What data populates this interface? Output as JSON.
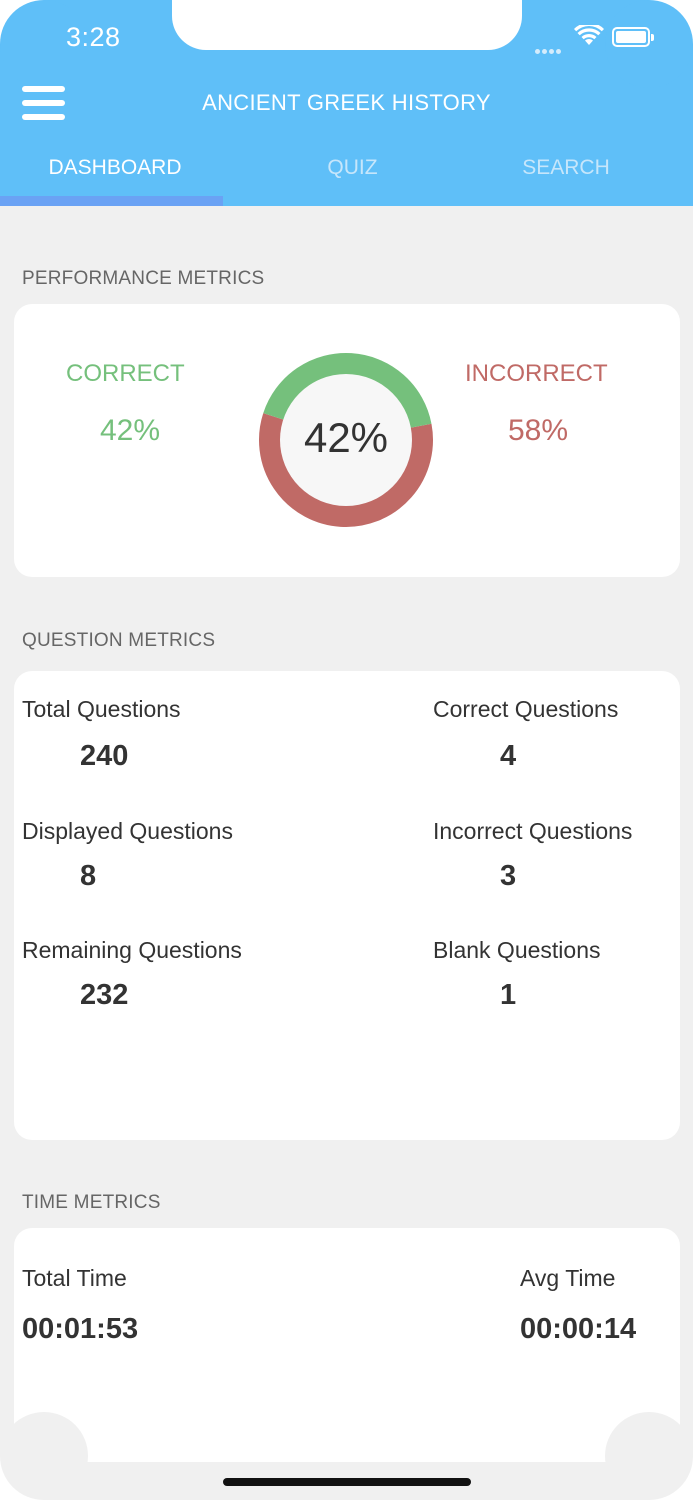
{
  "status_bar": {
    "time": "3:28"
  },
  "header": {
    "title": "ANCIENT GREEK HISTORY",
    "tabs": [
      {
        "label": "DASHBOARD",
        "active": true
      },
      {
        "label": "QUIZ",
        "active": false
      },
      {
        "label": "SEARCH",
        "active": false
      }
    ]
  },
  "performance": {
    "section_title": "PERFORMANCE METRICS",
    "correct_label": "CORRECT",
    "correct_value": "42%",
    "incorrect_label": "INCORRECT",
    "incorrect_value": "58%",
    "donut_center": "42%",
    "correct_fraction": 0.42,
    "colors": {
      "correct": "#75c07c",
      "incorrect": "#c06a66"
    }
  },
  "questions": {
    "section_title": "QUESTION METRICS",
    "total_label": "Total Questions",
    "total_value": "240",
    "displayed_label": "Displayed Questions",
    "displayed_value": "8",
    "remaining_label": "Remaining Questions",
    "remaining_value": "232",
    "correct_label": "Correct Questions",
    "correct_value": "4",
    "incorrect_label": "Incorrect Questions",
    "incorrect_value": "3",
    "blank_label": "Blank Questions",
    "blank_value": "1"
  },
  "time": {
    "section_title": "TIME METRICS",
    "total_label": "Total Time",
    "total_value": "00:01:53",
    "avg_label": "Avg Time",
    "avg_value": "00:00:14"
  },
  "icons": {
    "menu": "hamburger-menu-icon",
    "wifi": "wifi-icon",
    "battery": "battery-icon",
    "signal": "cellular-signal-icon"
  }
}
